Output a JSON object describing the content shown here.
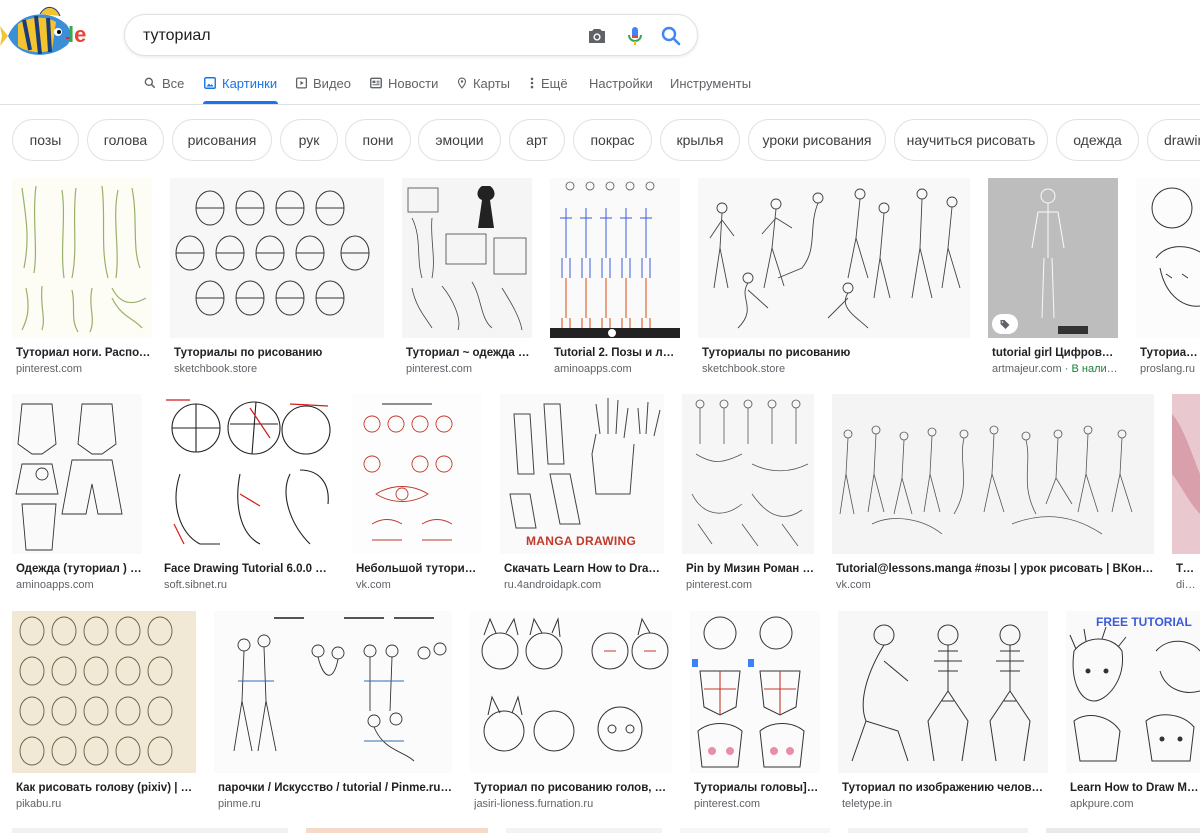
{
  "search": {
    "query": "туториал"
  },
  "logo": {
    "suffix_blue": "l",
    "suffix_red": "e"
  },
  "tabs": [
    {
      "label": "Все",
      "icon": "search-icon"
    },
    {
      "label": "Картинки",
      "icon": "image-icon",
      "active": true
    },
    {
      "label": "Видео",
      "icon": "video-icon"
    },
    {
      "label": "Новости",
      "icon": "news-icon"
    },
    {
      "label": "Карты",
      "icon": "map-pin-icon"
    },
    {
      "label": "Ещё",
      "icon": "more-vert-icon"
    },
    {
      "label": "Настройки"
    },
    {
      "label": "Инструменты"
    }
  ],
  "chips": [
    "позы",
    "голова",
    "рисования",
    "рук",
    "пони",
    "эмоции",
    "арт",
    "покрас",
    "крылья",
    "уроки рисования",
    "научиться рисовать",
    "одежда",
    "drawing"
  ],
  "results": [
    {
      "caption": "Туториал ноги. Располо…",
      "source": "pinterest.com"
    },
    {
      "caption": "Туториалы по рисованию",
      "source": "sketchbook.store"
    },
    {
      "caption": "Туториал ~ одежда / …",
      "source": "pinterest.com"
    },
    {
      "caption": "Tutorial 2. Позы и лиц…",
      "source": "aminoapps.com"
    },
    {
      "caption": "Туториалы по рисованию",
      "source": "sketchbook.store"
    },
    {
      "caption": "tutorial girl Цифровое …",
      "source": "artmajeur.com",
      "stock": " · В налич…"
    },
    {
      "caption": "Туториал: ч…",
      "source": "proslang.ru"
    },
    {
      "caption": "Одежда (туториал ) | …",
      "source": "aminoapps.com"
    },
    {
      "caption": "Face Drawing Tutorial 6.0.0 для…",
      "source": "soft.sibnet.ru"
    },
    {
      "caption": "Небольшой туториал …",
      "source": "vk.com"
    },
    {
      "caption": "Скачать Learn How to Draw …",
      "source": "ru.4androidapk.com",
      "overlay": "MANGA DRAWING"
    },
    {
      "caption": "Pin by Мизин Роман А…",
      "source": "pinterest.com"
    },
    {
      "caption": "Tutorial@lessons.manga #позы | урок рисовать | ВКонтакте",
      "source": "vk.com"
    },
    {
      "caption": "Туто…",
      "source": "diary…"
    },
    {
      "caption": "Как рисовать голову (pixiv) | Пи…",
      "source": "pikabu.ru"
    },
    {
      "caption": "парочки / Искусство / tutorial / Pinme.ru / …",
      "source": "pinme.ru"
    },
    {
      "caption": "Туториал по рисованию голов, Авт…",
      "source": "jasiri-lioness.furnation.ru"
    },
    {
      "caption": "Туториалы головы] | …",
      "source": "pinterest.com"
    },
    {
      "caption": "Туториал по изображению человека …",
      "source": "teletype.in"
    },
    {
      "caption": "Learn How to Draw Manga…",
      "source": "apkpure.com",
      "overlay": "FREE TUTORIAL"
    }
  ]
}
